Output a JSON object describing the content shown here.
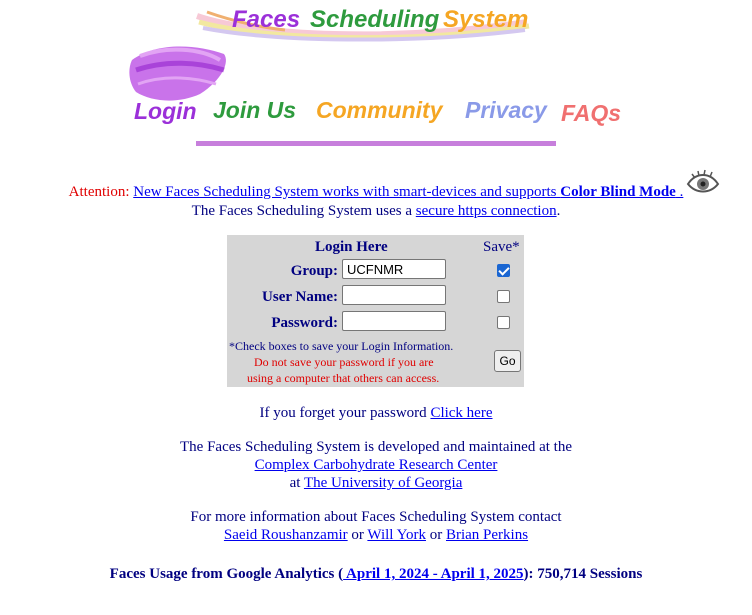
{
  "banner": {
    "word1": "Faces",
    "word2": "Scheduling",
    "word3": "System",
    "colors": [
      "#9b30d9",
      "#2e9b3e",
      "#f5a623"
    ]
  },
  "nav": {
    "items": [
      {
        "label": "Login",
        "color": "#9b30d9"
      },
      {
        "label": "Join Us",
        "color": "#2e9b3e"
      },
      {
        "label": "Community",
        "color": "#f5a623"
      },
      {
        "label": "Privacy",
        "color": "#8a9ae8"
      },
      {
        "label": "FAQs",
        "color": "#f07070"
      }
    ]
  },
  "attention": {
    "prefix": "Attention:",
    "link_text": "New Faces Scheduling System works with smart-devices and supports",
    "bold_link": "Color Blind Mode",
    "link_suffix": " .",
    "eye_icon": "eye-icon"
  },
  "secure": {
    "text": "The Faces Scheduling System uses a",
    "link": "secure https connection",
    "suffix": "."
  },
  "login": {
    "title": "Login Here",
    "save_header": "Save*",
    "group_label": "Group:",
    "group_value": "UCFNMR",
    "username_label": "User Name:",
    "username_value": "",
    "password_label": "Password:",
    "password_value": "",
    "save_group": true,
    "save_username": false,
    "save_password": false,
    "note1": "*Check boxes to save your Login Information.",
    "note2": "Do not save your password if you are",
    "note3": "using a computer that others can access.",
    "go_label": "Go"
  },
  "forgot": {
    "text": "If you forget your password",
    "link": "Click here"
  },
  "developed": {
    "line1": "The Faces Scheduling System is developed and maintained at the",
    "center_link": "Complex Carbohydrate Research Center",
    "at": "at",
    "univ_link": "The University of Georgia"
  },
  "contact": {
    "line1": "For more information about Faces Scheduling System contact",
    "person1": "Saeid Roushanzamir",
    "or1": "or",
    "person2": "Will York",
    "or2": "or",
    "person3": "Brian Perkins"
  },
  "usage": {
    "prefix": "Faces Usage from Google Analytics (",
    "range_link": " April 1, 2024 - April 1, 2025",
    "suffix": "): 750,714 Sessions"
  }
}
